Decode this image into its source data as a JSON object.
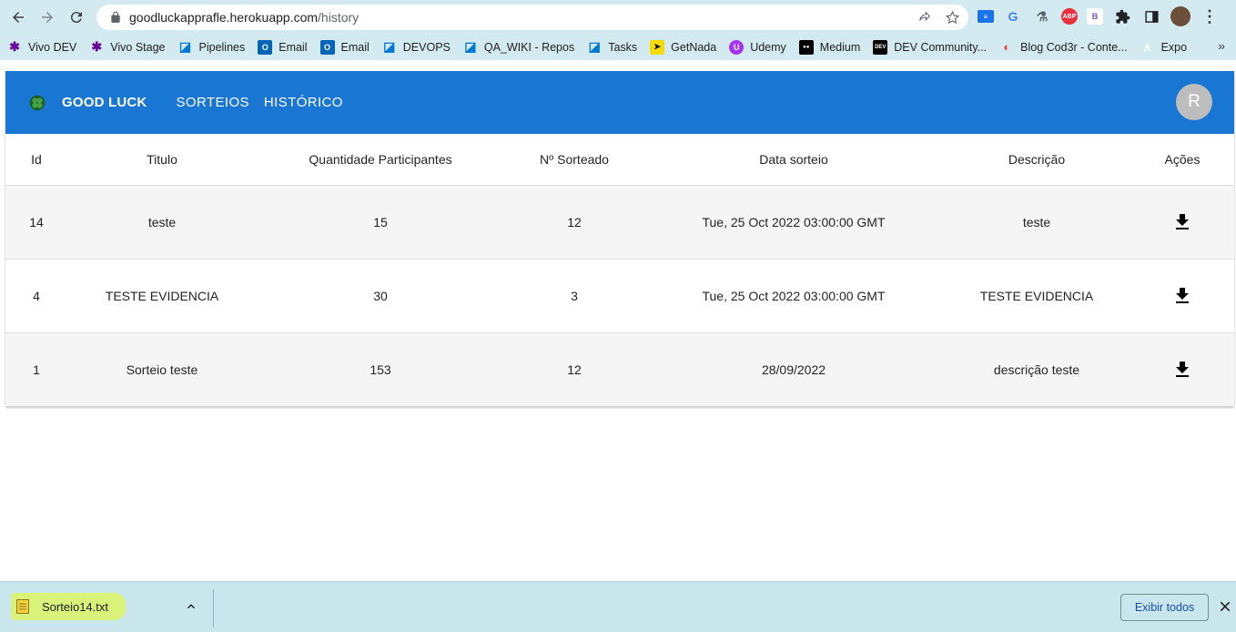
{
  "browser": {
    "url_host": "goodluckapprafle.herokuapp.com",
    "url_path": "/history",
    "bookmarks": [
      {
        "label": "Vivo DEV",
        "icon": "vivo-icon",
        "color": "#660099"
      },
      {
        "label": "Vivo Stage",
        "icon": "vivo-icon",
        "color": "#660099"
      },
      {
        "label": "Pipelines",
        "icon": "azure-devops-icon",
        "color": "#0078d4"
      },
      {
        "label": "Email",
        "icon": "outlook-icon",
        "color": "#0364b8"
      },
      {
        "label": "Email",
        "icon": "outlook-icon",
        "color": "#0364b8"
      },
      {
        "label": "DEVOPS",
        "icon": "azure-devops-icon",
        "color": "#0078d4"
      },
      {
        "label": "QA_WIKI - Repos",
        "icon": "azure-devops-icon",
        "color": "#0078d4"
      },
      {
        "label": "Tasks",
        "icon": "azure-devops-icon",
        "color": "#0078d4"
      },
      {
        "label": "GetNada",
        "icon": "getnada-icon",
        "color": "#f5d90a"
      },
      {
        "label": "Udemy",
        "icon": "udemy-icon",
        "color": "#a435f0"
      },
      {
        "label": "Medium",
        "icon": "medium-icon",
        "color": "#000000"
      },
      {
        "label": "DEV Community...",
        "icon": "dev-icon",
        "color": "#000000"
      },
      {
        "label": "Blog Cod3r - Conte...",
        "icon": "google-icon",
        "color": "#ea4335"
      },
      {
        "label": "Expo",
        "icon": "expo-icon",
        "color": "#000020"
      }
    ]
  },
  "app": {
    "brand": "GOOD LUCK",
    "nav": [
      "SORTEIOS",
      "HISTÓRICO"
    ],
    "user_initial": "R",
    "primary_color": "#1976d2"
  },
  "table": {
    "headers": [
      "Id",
      "Titulo",
      "Quantidade Participantes",
      "Nº Sorteado",
      "Data sorteio",
      "Descrição",
      "Ações"
    ],
    "rows": [
      {
        "id": "14",
        "titulo": "teste",
        "qtd": "15",
        "numero": "12",
        "data": "Tue, 25 Oct 2022 03:00:00 GMT",
        "descricao": "teste",
        "acao_icon": "download-icon"
      },
      {
        "id": "4",
        "titulo": "TESTE EVIDENCIA",
        "qtd": "30",
        "numero": "3",
        "data": "Tue, 25 Oct 2022 03:00:00 GMT",
        "descricao": "TESTE EVIDENCIA",
        "acao_icon": "download-icon"
      },
      {
        "id": "1",
        "titulo": "Sorteio teste",
        "qtd": "153",
        "numero": "12",
        "data": "28/09/2022",
        "descricao": "descrição teste",
        "acao_icon": "download-icon"
      }
    ]
  },
  "download_shelf": {
    "file_name": "Sorteio14.txt",
    "show_all_label": "Exibir todos"
  }
}
